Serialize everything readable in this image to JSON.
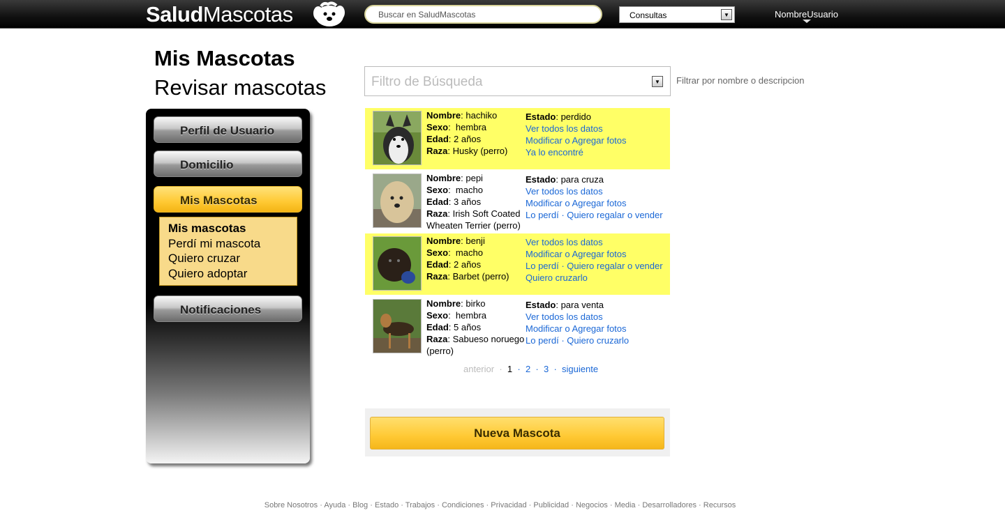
{
  "header": {
    "logo_bold": "Salud",
    "logo_rest": "Mascotas",
    "search_placeholder": "Buscar en SaludMascotas",
    "dropdown_selected": "Consultas",
    "username": "NombreUsuario"
  },
  "page": {
    "title": "Mis Mascotas",
    "subtitle": "Revisar mascotas"
  },
  "sidebar": {
    "items": [
      {
        "label": "Perfil de Usuario"
      },
      {
        "label": "Domicilio"
      },
      {
        "label": "Mis Mascotas"
      },
      {
        "label": "Notificaciones"
      }
    ],
    "submenu": [
      {
        "label": "Mis mascotas"
      },
      {
        "label": "Perdí mi mascota"
      },
      {
        "label": "Quiero cruzar"
      },
      {
        "label": "Quiero adoptar"
      }
    ]
  },
  "filter": {
    "placeholder": "Filtro de Búsqueda",
    "hint": "Filtrar por nombre o descripcion"
  },
  "labels": {
    "name": "Nombre",
    "sex": "Sexo",
    "age": "Edad",
    "breed": "Raza",
    "state": "Estado"
  },
  "pets": [
    {
      "name": "hachiko",
      "sex": "hembra",
      "age": "2 años",
      "breed": "Husky (perro)",
      "state": "perdido",
      "links": [
        "Ver todos los datos",
        "Modificar o Agregar fotos",
        "Ya lo encontré"
      ]
    },
    {
      "name": "pepi",
      "sex": "macho",
      "age": "3 años",
      "breed": "Irish Soft Coated Wheaten Terrier (perro)",
      "state": "para cruza",
      "links": [
        "Ver todos los datos",
        "Modificar o Agregar fotos",
        "Lo perdí",
        "Quiero regalar o vender"
      ]
    },
    {
      "name": "benji",
      "sex": "macho",
      "age": "2 años",
      "breed": "Barbet (perro)",
      "links": [
        "Ver todos los datos",
        "Modificar o Agregar fotos",
        "Lo perdí",
        "Quiero regalar o vender",
        "Quiero cruzarlo"
      ]
    },
    {
      "name": "birko",
      "sex": "hembra",
      "age": "5 años",
      "breed": "Sabueso noruego (perro)",
      "state": "para venta",
      "links": [
        "Ver todos los datos",
        "Modificar o Agregar fotos",
        "Lo perdí",
        "Quiero cruzarlo"
      ]
    }
  ],
  "pager": {
    "prev": "anterior",
    "pages": [
      "1",
      "2",
      "3"
    ],
    "next": "siguiente",
    "sep": "·"
  },
  "new_pet_label": "Nueva Mascota",
  "footer": {
    "links": [
      "Sobre Nosotros",
      "Ayuda",
      "Blog",
      "Estado",
      "Trabajos",
      "Condiciones",
      "Privacidad",
      "Publicidad",
      "Negocios",
      "Media",
      "Desarrolladores",
      "Recursos"
    ],
    "sep": " · "
  },
  "colors": {
    "accent_yellow": "#ffc934",
    "row_highlight": "#ffff66",
    "link_blue": "#1a67d6"
  }
}
